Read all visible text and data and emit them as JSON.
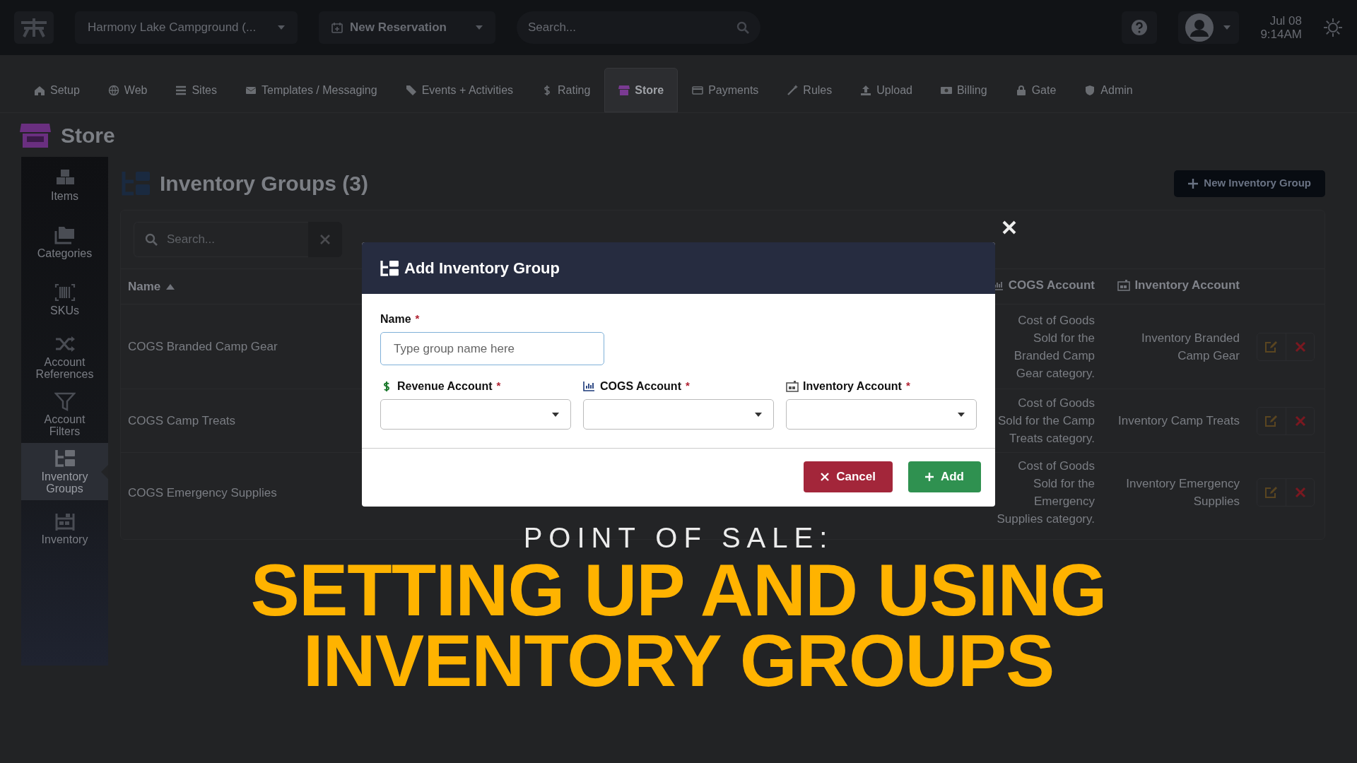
{
  "topbar": {
    "park_selector": "Harmony Lake Campground (...",
    "reservation_button": "New Reservation",
    "search": {
      "placeholder": "Search..."
    },
    "date": "Jul 08",
    "time": "9:14AM"
  },
  "tabs": [
    {
      "label": "Setup",
      "selected": false
    },
    {
      "label": "Web",
      "selected": false
    },
    {
      "label": "Sites",
      "selected": false
    },
    {
      "label": "Templates / Messaging",
      "selected": false
    },
    {
      "label": "Events + Activities",
      "selected": false
    },
    {
      "label": "Rating",
      "selected": false
    },
    {
      "label": "Store",
      "selected": true
    },
    {
      "label": "Payments",
      "selected": false
    },
    {
      "label": "Rules",
      "selected": false
    },
    {
      "label": "Upload",
      "selected": false
    },
    {
      "label": "Billing",
      "selected": false
    },
    {
      "label": "Gate",
      "selected": false
    },
    {
      "label": "Admin",
      "selected": false
    }
  ],
  "page_title": "Store",
  "sidebar": {
    "items": [
      {
        "label": "Items",
        "selected": false
      },
      {
        "label": "Categories",
        "selected": false
      },
      {
        "label": "SKUs",
        "selected": false
      },
      {
        "label": "Account References",
        "selected": false
      },
      {
        "label": "Account Filters",
        "selected": false
      },
      {
        "label": "Inventory Groups",
        "selected": true
      },
      {
        "label": "Inventory",
        "selected": false
      }
    ]
  },
  "section": {
    "title": "Inventory Groups (3)",
    "new_button": "New Inventory Group",
    "search": {
      "placeholder": "Search..."
    }
  },
  "table": {
    "columns": [
      {
        "label": "Name",
        "sorted_ascending": true
      },
      {
        "label": "COGS Account",
        "sorted_ascending": false
      },
      {
        "label": "Inventory Account",
        "sorted_ascending": false
      }
    ],
    "rows": [
      {
        "name": "COGS Branded Camp Gear",
        "cogs_account": "Cost of Goods Sold for the Branded Camp Gear category.",
        "inventory_account": "Inventory Branded Camp Gear"
      },
      {
        "name": "COGS Camp Treats",
        "cogs_account": "Cost of Goods Sold for the Camp Treats category.",
        "inventory_account": "Inventory Camp Treats"
      },
      {
        "name": "COGS Emergency Supplies",
        "cogs_account": "Cost of Goods Sold for the Emergency Supplies category.",
        "inventory_account": "Inventory Emergency Supplies"
      }
    ]
  },
  "modal": {
    "title": "Add Inventory Group",
    "name_field": {
      "label": "Name",
      "required_mark": "*",
      "placeholder": "Type group name here"
    },
    "selects": [
      {
        "label": "Revenue Account",
        "required_mark": "*"
      },
      {
        "label": "COGS Account",
        "required_mark": "*"
      },
      {
        "label": "Inventory Account",
        "required_mark": "*"
      }
    ],
    "buttons": [
      {
        "label": "Cancel",
        "kind": "cancel"
      },
      {
        "label": "Add",
        "kind": "add"
      }
    ]
  },
  "overlay": {
    "kicker": "POINT OF SALE:",
    "headline_lines": [
      "SETTING UP AND USING",
      "INVENTORY GROUPS"
    ]
  }
}
